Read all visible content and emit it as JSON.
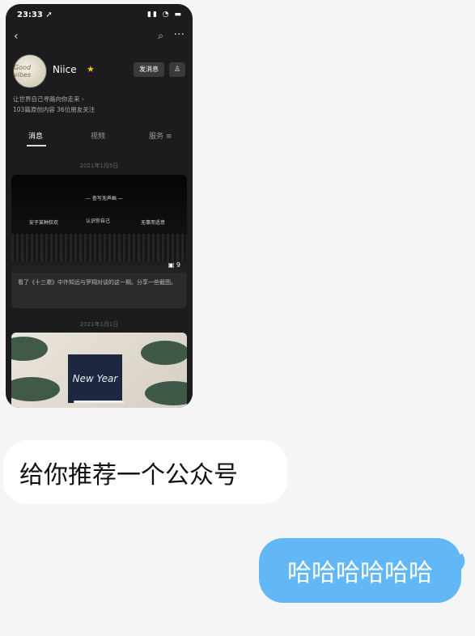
{
  "screenshot": {
    "status_bar": {
      "time": "23:33 ➚",
      "icons": "▮▮ ◔ ▬"
    },
    "nav": {
      "back_icon": "‹",
      "search_icon": "⌕",
      "more_icon": "···"
    },
    "profile": {
      "name": "Niice",
      "star_icon": "★",
      "message_button": "发消息",
      "follow_icon": "♙",
      "avatar_text": "Good vibes",
      "bio": "让世界自己寻路向你走来 ›",
      "stats": "103篇原创内容   36位朋友关注"
    },
    "tabs": [
      {
        "label": "消息"
      },
      {
        "label": "视频"
      },
      {
        "label": "服务 ≡"
      }
    ],
    "feed": [
      {
        "date": "2021年1月5日",
        "image_texts": [
          "— 查写无声画 —",
          "安于某种狂欢",
          "认识你自己",
          "无事而适意"
        ],
        "image_count": "9",
        "caption": "看了《十三邀》中许知远与罗翔对谈的这一期。分享一些截图。"
      },
      {
        "date": "2021年1月1日",
        "image_text": "New Year"
      }
    ]
  },
  "chat": {
    "incoming_message": "给你推荐一个公众号",
    "outgoing_message": "哈哈哈哈哈哈",
    "outgoing_bubble_color": "#62b8f6"
  }
}
